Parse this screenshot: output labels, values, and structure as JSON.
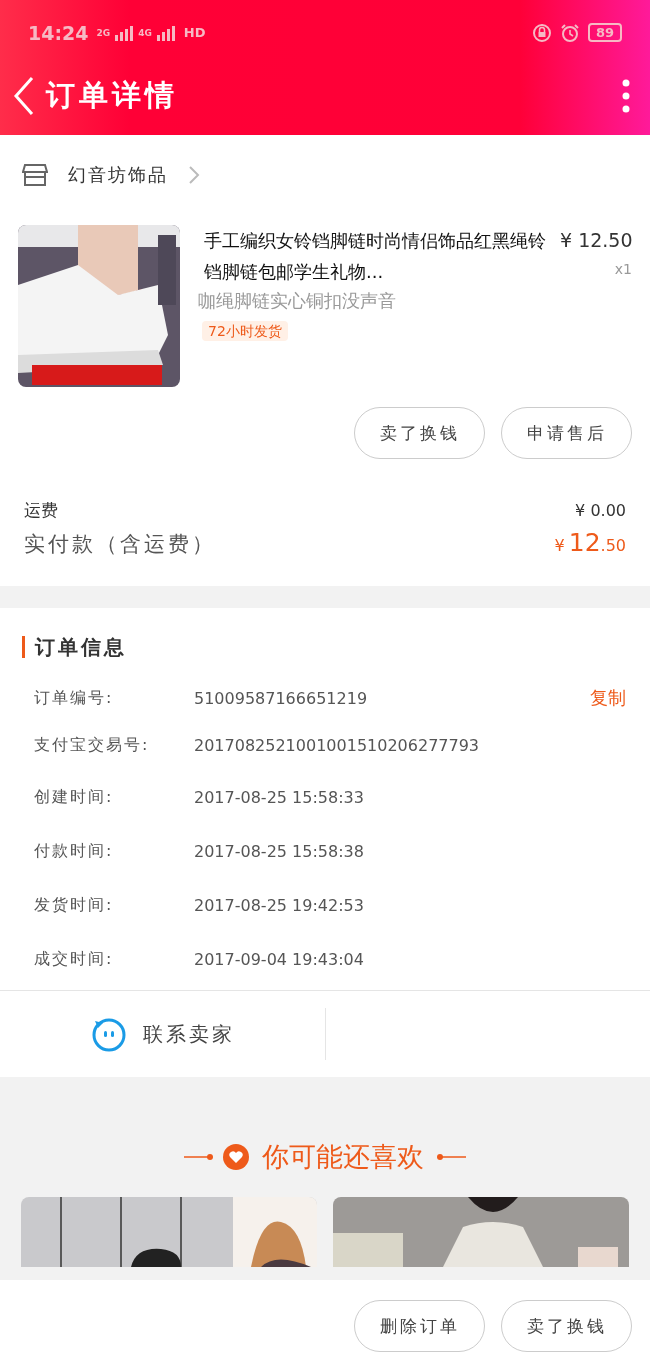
{
  "status_bar": {
    "time": "14:24",
    "network_1": "2G",
    "network_2": "4G",
    "hd": "HD",
    "battery": "89"
  },
  "header": {
    "title": "订单详情"
  },
  "shop": {
    "name": "幻音坊饰品"
  },
  "product": {
    "title": "手工编织女铃铛脚链时尚情侣饰品红黑绳铃铛脚链包邮学生礼物...",
    "price": "¥ 12.50",
    "quantity": "x1",
    "variant": "咖绳脚链实心铜扣没声音",
    "tag": "72小时发货"
  },
  "product_buttons": [
    "卖了换钱",
    "申请售后"
  ],
  "fees": [
    {
      "kind": "plain",
      "label": "运费",
      "value": "¥ 0.00"
    },
    {
      "kind": "total",
      "label": "实付款（含运费）",
      "currency": "¥",
      "value": "12",
      "cents": ".50"
    }
  ],
  "order_info": {
    "title": "订单信息",
    "rows": [
      {
        "label": "订单编号:",
        "value": "51009587166651219",
        "action": "复制"
      },
      {
        "label": "支付宝交易号:",
        "value": "2017082521001001510206277793"
      },
      {
        "label": "创建时间:",
        "value": "2017-08-25 15:58:33"
      },
      {
        "label": "付款时间:",
        "value": "2017-08-25 15:58:38"
      },
      {
        "label": "发货时间:",
        "value": "2017-08-25 19:42:53"
      },
      {
        "label": "成交时间:",
        "value": "2017-09-04 19:43:04"
      }
    ]
  },
  "contact": {
    "label": "联系卖家"
  },
  "recommend": {
    "title": "你可能还喜欢"
  },
  "bottom_buttons": [
    "删除订单",
    "卖了换钱"
  ]
}
